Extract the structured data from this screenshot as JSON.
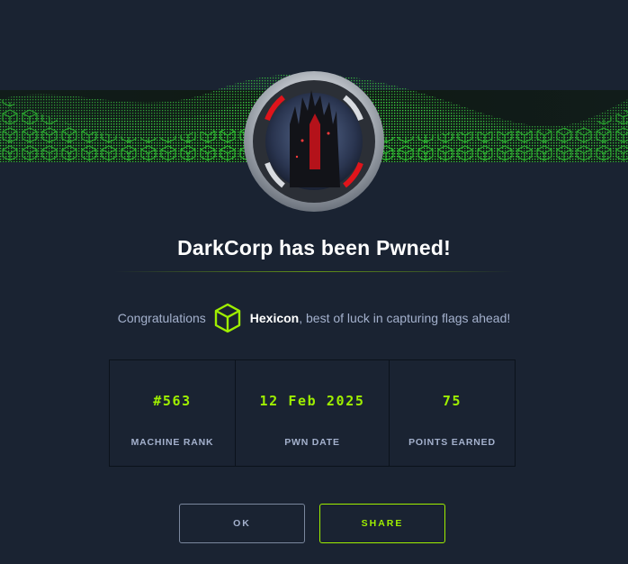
{
  "modal": {
    "title": "DarkCorp has been Pwned!",
    "congrats_prefix": "Congratulations",
    "username": "Hexicon",
    "congrats_suffix": ", best of luck in capturing flags ahead!"
  },
  "stats": [
    {
      "value": "#563",
      "label": "MACHINE RANK"
    },
    {
      "value": "12 Feb 2025",
      "label": "PWN DATE"
    },
    {
      "value": "75",
      "label": "POINTS EARNED"
    }
  ],
  "buttons": {
    "ok_label": "OK",
    "share_label": "SHARE"
  },
  "colors": {
    "background": "#1a2332",
    "accent": "#9fef00",
    "text_muted": "#a4b1cd"
  },
  "icons": {
    "banner": "green-wave-grid-banner",
    "machine": "machine-avatar-badge",
    "user": "user-cube-icon"
  }
}
